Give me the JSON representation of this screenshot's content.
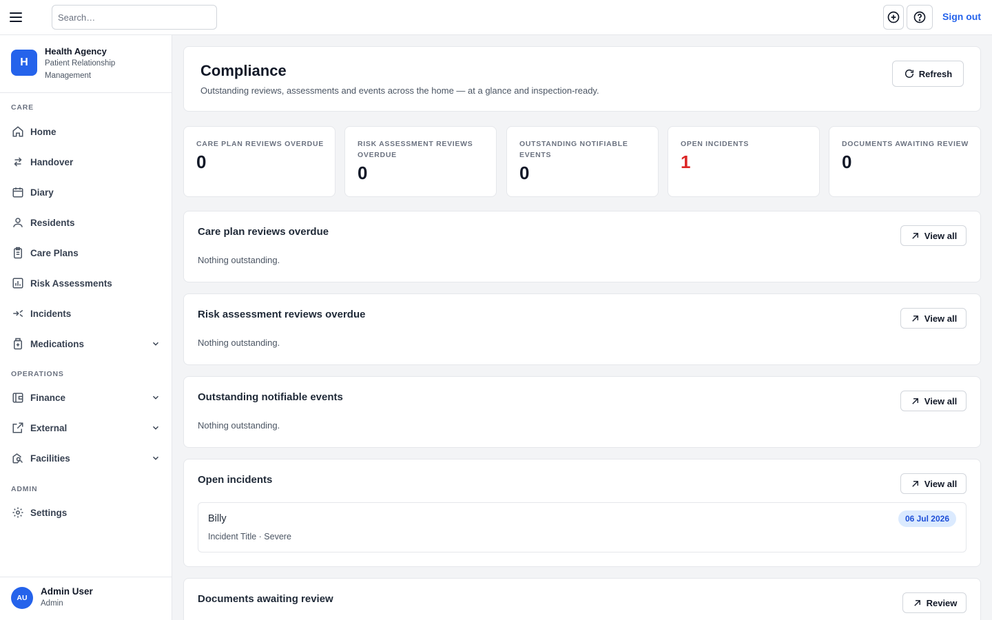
{
  "topbar": {
    "search_placeholder": "Search…",
    "signout_label": "Sign out"
  },
  "brand": {
    "logo_letter": "H",
    "name": "Health Agency",
    "subtitle": "Patient Relationship Management"
  },
  "sidebar": {
    "sections": {
      "care": "CARE",
      "operations": "OPERATIONS",
      "admin": "ADMIN"
    },
    "items": [
      {
        "label": "Home",
        "icon": "home-icon"
      },
      {
        "label": "Handover",
        "icon": "arrows-left-right-icon"
      },
      {
        "label": "Diary",
        "icon": "calendar-icon"
      },
      {
        "label": "Residents",
        "icon": "user-icon"
      },
      {
        "label": "Care Plans",
        "icon": "clipboard-icon"
      },
      {
        "label": "Risk Assessments",
        "icon": "bar-chart-icon"
      },
      {
        "label": "Incidents",
        "icon": "arrows-merge-icon"
      },
      {
        "label": "Medications",
        "icon": "medical-box-icon"
      },
      {
        "label": "Finance",
        "icon": "wallet-icon"
      },
      {
        "label": "External",
        "icon": "external-link-icon"
      },
      {
        "label": "Facilities",
        "icon": "building-icon"
      },
      {
        "label": "Settings",
        "icon": "gear-icon"
      }
    ]
  },
  "user": {
    "initials": "AU",
    "name": "Admin User",
    "role": "Admin"
  },
  "page": {
    "title": "Compliance",
    "subtitle": "Outstanding reviews, assessments and events across the home — at a glance and inspection-ready.",
    "refresh_label": "Refresh"
  },
  "stats": [
    {
      "label": "Care plan reviews overdue",
      "value": "0"
    },
    {
      "label": "Risk assessment reviews overdue",
      "value": "0"
    },
    {
      "label": "Outstanding notifiable events",
      "value": "0"
    },
    {
      "label": "Open incidents",
      "value": "1",
      "color": "#dc2626"
    },
    {
      "label": "Documents awaiting review",
      "value": "0"
    }
  ],
  "sections": [
    {
      "title": "Care plan reviews overdue",
      "empty": "Nothing outstanding.",
      "action": "View all"
    },
    {
      "title": "Risk assessment reviews overdue",
      "empty": "Nothing outstanding.",
      "action": "View all"
    },
    {
      "title": "Outstanding notifiable events",
      "empty": "Nothing outstanding.",
      "action": "View all"
    },
    {
      "title": "Open incidents",
      "action": "View all",
      "items": [
        {
          "name": "Billy",
          "meta": "Incident Title · Severe",
          "date": "06 Jul 2026"
        }
      ]
    },
    {
      "title": "Documents awaiting review",
      "action": "Review"
    }
  ],
  "colors": {
    "accent": "#2563eb",
    "danger": "#dc2626",
    "badge_bg": "#dbeafe"
  }
}
